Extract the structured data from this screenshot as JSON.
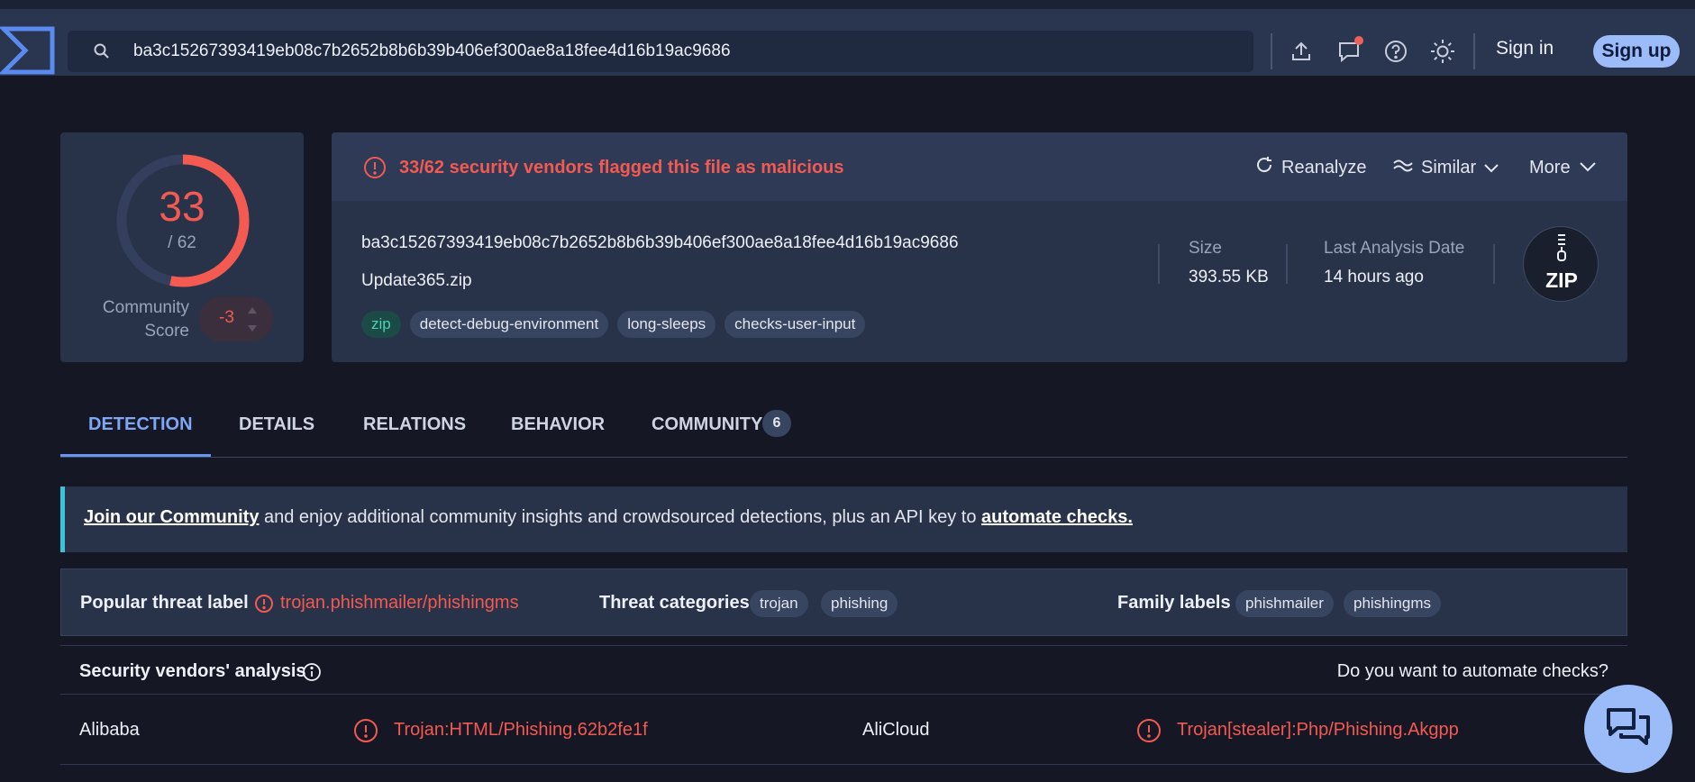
{
  "header": {
    "search_value": "ba3c15267393419eb08c7b2652b8b6b39b406ef300ae8a18fee4d16b19ac9686",
    "signin_label": "Sign in",
    "signup_label": "Sign up",
    "icons": [
      "logo-icon",
      "search-icon",
      "upload-icon",
      "chat-icon",
      "help-icon",
      "theme-icon"
    ]
  },
  "score": {
    "detections": "33",
    "total": "/ 62",
    "detections_fraction": 0.532,
    "community_label_line1": "Community",
    "community_label_line2": "Score",
    "community_value": "-3"
  },
  "file": {
    "alert": "33/62 security vendors flagged this file as malicious",
    "actions": {
      "reanalyze": "Reanalyze",
      "similar": "Similar",
      "more": "More"
    },
    "hash": "ba3c15267393419eb08c7b2652b8b6b39b406ef300ae8a18fee4d16b19ac9686",
    "name": "Update365.zip",
    "tags": [
      "zip",
      "detect-debug-environment",
      "long-sleeps",
      "checks-user-input"
    ],
    "size_label": "Size",
    "size_value": "393.55 KB",
    "date_label": "Last Analysis Date",
    "date_value": "14 hours ago",
    "type_badge": "ZIP"
  },
  "tabs": [
    {
      "label": "DETECTION",
      "active": true
    },
    {
      "label": "DETAILS"
    },
    {
      "label": "RELATIONS"
    },
    {
      "label": "BEHAVIOR"
    },
    {
      "label": "COMMUNITY",
      "count": "6"
    }
  ],
  "banner": {
    "link1": "Join our Community",
    "middle": " and enjoy additional community insights and crowdsourced detections, plus an API key to ",
    "link2": "automate checks."
  },
  "threat": {
    "popular_label": "Popular threat label",
    "popular_value": "trojan.phishmailer/phishingms",
    "categories_label": "Threat categories",
    "categories": [
      "trojan",
      "phishing"
    ],
    "family_label": "Family labels",
    "families": [
      "phishmailer",
      "phishingms"
    ]
  },
  "vendors": {
    "title": "Security vendors' analysis",
    "automate_question": "Do you want to automate checks?",
    "rows": [
      {
        "vendor1": "Alibaba",
        "result1": "Trojan:HTML/Phishing.62b2fe1f",
        "vendor2": "AliCloud",
        "result2": "Trojan[stealer]:Php/Phishing.Akgpp"
      }
    ]
  },
  "colors": {
    "malicious": "#f25a52",
    "accent": "#7fa7f5",
    "topbar": "#2a3550",
    "background": "#161724",
    "card": "#283249"
  }
}
